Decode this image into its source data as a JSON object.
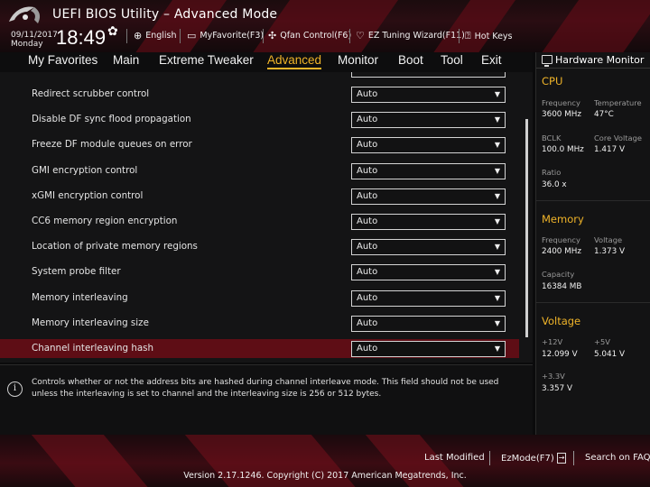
{
  "app": {
    "title": "UEFI BIOS Utility – Advanced Mode"
  },
  "status": {
    "date": "09/11/2017",
    "day": "Monday",
    "time": "18:49"
  },
  "toolbar": {
    "language": "English",
    "my_favorite": "MyFavorite(F3)",
    "qfan": "Qfan Control(F6)",
    "ez_tuning": "EZ Tuning Wizard(F11)",
    "hot_keys": "Hot Keys"
  },
  "menu": {
    "items": [
      "My Favorites",
      "Main",
      "Extreme Tweaker",
      "Advanced",
      "Monitor",
      "Boot",
      "Tool",
      "Exit"
    ],
    "active": "Advanced"
  },
  "settings": [
    {
      "label": "Redirect scrubber control",
      "value": "Auto"
    },
    {
      "label": "Disable DF sync flood propagation",
      "value": "Auto"
    },
    {
      "label": "Freeze DF module queues on error",
      "value": "Auto"
    },
    {
      "label": "GMI encryption control",
      "value": "Auto"
    },
    {
      "label": "xGMI encryption control",
      "value": "Auto"
    },
    {
      "label": "CC6 memory region encryption",
      "value": "Auto"
    },
    {
      "label": "Location of private memory regions",
      "value": "Auto"
    },
    {
      "label": "System probe filter",
      "value": "Auto"
    },
    {
      "label": "Memory interleaving",
      "value": "Auto"
    },
    {
      "label": "Memory interleaving size",
      "value": "Auto"
    },
    {
      "label": "Channel interleaving hash",
      "value": "Auto",
      "selected": true
    }
  ],
  "help": {
    "text": "Controls whether or not the address bits are hashed during channel interleave mode. This field should not be used unless the interleaving is set to channel and the interleaving size is 256 or 512 bytes."
  },
  "hardware_monitor": {
    "title": "Hardware Monitor",
    "cpu": {
      "heading": "CPU",
      "frequency_label": "Frequency",
      "frequency": "3600 MHz",
      "temperature_label": "Temperature",
      "temperature": "47°C",
      "bclk_label": "BCLK",
      "bclk": "100.0 MHz",
      "core_voltage_label": "Core Voltage",
      "core_voltage": "1.417 V",
      "ratio_label": "Ratio",
      "ratio": "36.0 x"
    },
    "memory": {
      "heading": "Memory",
      "frequency_label": "Frequency",
      "frequency": "2400 MHz",
      "voltage_label": "Voltage",
      "voltage": "1.373 V",
      "capacity_label": "Capacity",
      "capacity": "16384 MB"
    },
    "voltage": {
      "heading": "Voltage",
      "v12_label": "+12V",
      "v12": "12.099 V",
      "v5_label": "+5V",
      "v5": "5.041 V",
      "v33_label": "+3.3V",
      "v33": "3.357 V"
    }
  },
  "bottom": {
    "last_modified": "Last Modified",
    "ez_mode": "EzMode(F7)",
    "search": "Search on FAQ",
    "version": "Version 2.17.1246. Copyright (C) 2017 American Megatrends, Inc."
  },
  "colors": {
    "accent": "#f0b429",
    "selected_row": "#5e0d15",
    "brand_red": "#7c0f1c"
  }
}
